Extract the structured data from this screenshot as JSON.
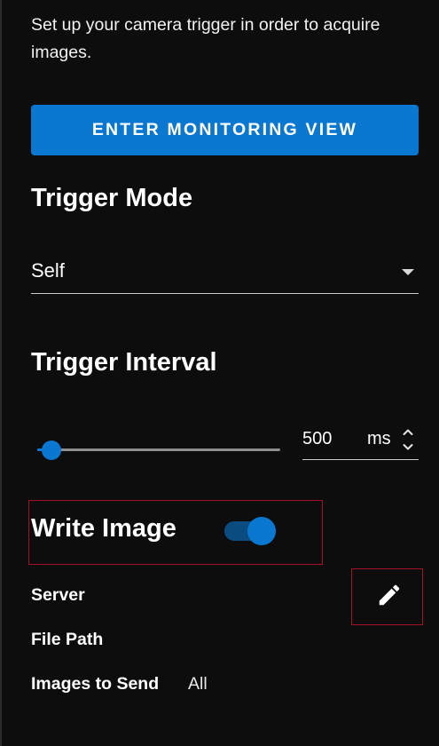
{
  "intro_text": "Set up your camera trigger in order to acquire images.",
  "monitor_button": {
    "label": "ENTER MONITORING VIEW"
  },
  "trigger_mode": {
    "title": "Trigger Mode",
    "selected": "Self"
  },
  "trigger_interval": {
    "title": "Trigger Interval",
    "value": "500",
    "unit": "ms",
    "slider_fraction": 0.06
  },
  "write_image": {
    "label": "Write Image",
    "enabled": true
  },
  "fields": {
    "server_label": "Server",
    "file_path_label": "File Path",
    "images_to_send_label": "Images to Send",
    "images_to_send_value": "All"
  },
  "icons": {
    "edit": "pencil-icon",
    "dropdown": "caret-down-icon",
    "stepper": "unfold-icon"
  },
  "colors": {
    "background": "#0d0d0e",
    "accent": "#0a78d0",
    "toggle_track": "#0b4c80",
    "highlight_outline": "#a3122a"
  }
}
